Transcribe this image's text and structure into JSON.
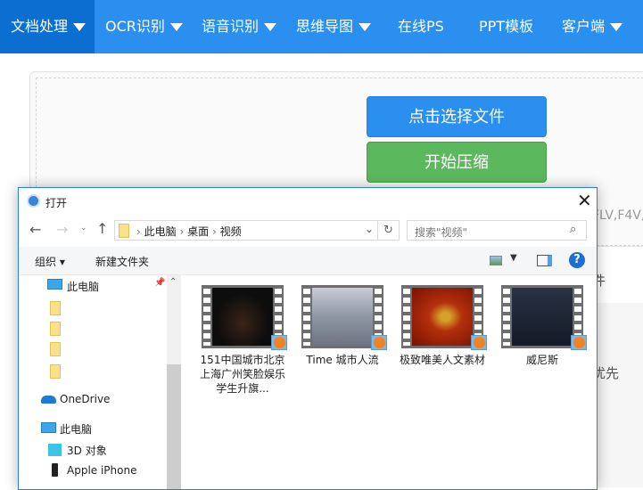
{
  "nav": {
    "items": [
      {
        "label": "文档处理",
        "dropdown": true,
        "active": true
      },
      {
        "label": "OCR识别",
        "dropdown": true
      },
      {
        "label": "语音识别",
        "dropdown": true
      },
      {
        "label": "思维导图",
        "dropdown": true
      },
      {
        "label": "在线PS",
        "dropdown": false
      },
      {
        "label": "PPT模板",
        "dropdown": false
      },
      {
        "label": "客户端",
        "dropdown": true
      }
    ]
  },
  "upload": {
    "select_label": "点击选择文件",
    "start_label": "开始压缩",
    "formats_partial": "FLV,F4V,",
    "partial_1": "件",
    "partial_2": "优先"
  },
  "colors": {
    "nav": "#2a8fef",
    "nav_active": "#0a6fd0",
    "select_button": "#2a8fef",
    "start_button": "#5cb85c"
  },
  "dialog": {
    "title": "打开",
    "breadcrumb": [
      "此电脑",
      "桌面",
      "视频"
    ],
    "search_placeholder": "搜索\"视频\"",
    "toolbar": {
      "organize": "组织",
      "new_folder": "新建文件夹"
    },
    "nav_pane": {
      "quick_access": "此电脑",
      "onedrive": "OneDrive",
      "this_pc": "此电脑",
      "items": [
        "3D 对象",
        "Apple iPhone"
      ]
    },
    "files": [
      {
        "name": "151中国城市北京上海广州笑脸娱乐学生升旗..."
      },
      {
        "name": "Time 城市人流"
      },
      {
        "name": "极致唯美人文素材"
      },
      {
        "name": "威尼斯"
      }
    ]
  }
}
